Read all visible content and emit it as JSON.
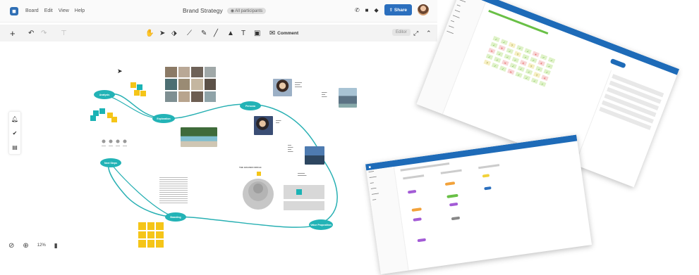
{
  "app": {
    "title": "Brand Strategy",
    "participants_badge": "All participants",
    "menus": [
      "Board",
      "Edit",
      "View",
      "Help"
    ],
    "share_label": "Share",
    "comment_label": "Comment",
    "editor_label": "Editor",
    "zoom_level": "12%"
  },
  "toolbar": {
    "icons": [
      "plus-icon",
      "undo-icon",
      "redo-icon",
      "format-icon",
      "hand-icon",
      "pointer-icon",
      "eraser-icon",
      "connector-icon",
      "pen-icon",
      "line-icon",
      "shapes-icon",
      "text-icon",
      "sticky-icon",
      "comment-icon"
    ]
  },
  "nodes": [
    {
      "id": "analysis",
      "label": "Analysis"
    },
    {
      "id": "exploration",
      "label": "Exploration"
    },
    {
      "id": "persona",
      "label": "Persona"
    },
    {
      "id": "next_steps",
      "label": "Next Steps"
    },
    {
      "id": "branding",
      "label": "Branding"
    },
    {
      "id": "value_prop",
      "label": "Value Proposition"
    }
  ],
  "canvas_labels": {
    "golden_circle": "THE GOLDEN CIRCLE"
  },
  "colors": {
    "accent": "#2b6fbe",
    "teal": "#23b3b6",
    "sticky_yellow": "#f5c518",
    "sticky_teal": "#1bb3b5"
  }
}
